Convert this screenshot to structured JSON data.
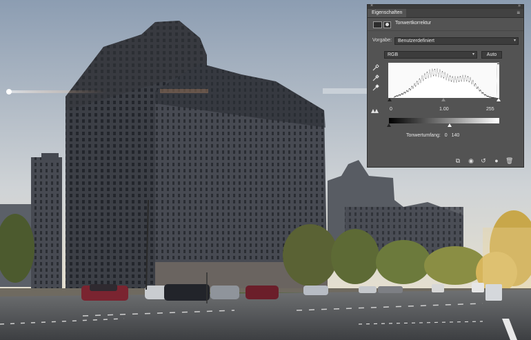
{
  "panel": {
    "close_glyph": "×",
    "collapse_glyph": "»",
    "tab_label": "Eigenschaften",
    "menu_glyph": "≡",
    "adjustment_title": "Tonwertkorrektur",
    "preset_label": "Vorgabe:",
    "preset_value": "Benutzerdefiniert",
    "channel_value": "RGB",
    "auto_label": "Auto",
    "input_levels": {
      "black": "0",
      "gamma": "1.00",
      "white": "255"
    },
    "input_levels_fraction": {
      "black": 0.0,
      "gamma": 0.5,
      "white": 1.0
    },
    "output_label": "Tonwertumfang:",
    "output_levels": {
      "black": "0",
      "white": "140"
    },
    "output_levels_fraction": {
      "black": 0.0,
      "white": 0.549
    },
    "icons": {
      "eyedroppers": [
        "black-point-eyedropper-icon",
        "gray-point-eyedropper-icon",
        "white-point-eyedropper-icon"
      ],
      "footer": [
        "clip-to-layer-icon",
        "view-previous-state-icon",
        "reset-icon",
        "toggle-visibility-icon",
        "delete-icon"
      ]
    }
  },
  "colors": {
    "panel_bg": "#535353",
    "histogram_bg": "#fafafa",
    "sky_top": "#8fa0b4",
    "sky_bottom": "#e8e2d0"
  }
}
